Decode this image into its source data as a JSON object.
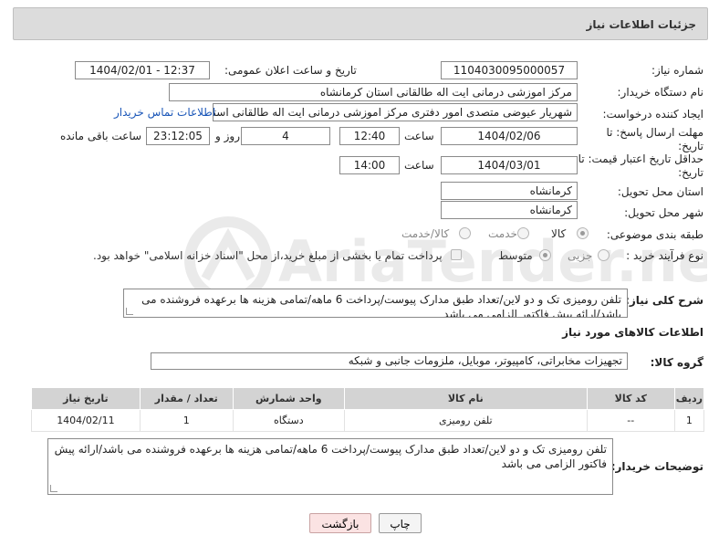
{
  "header": {
    "title": "جزئیات اطلاعات نیاز"
  },
  "labels": {
    "need_number": "شماره نیاز:",
    "announce_datetime": "تاریخ و ساعت اعلان عمومی:",
    "buyer_org": "نام دستگاه خریدار:",
    "requester": "ایجاد کننده درخواست:",
    "reply_deadline": "مهلت ارسال پاسخ: تا تاریخ:",
    "time_word": "ساعت",
    "day_and": "روز و",
    "remaining": "ساعت باقی مانده",
    "price_validity": "حداقل تاریخ اعتبار قیمت: تا تاریخ:",
    "delivery_province": "استان محل تحویل:",
    "delivery_city": "شهر محل تحویل:",
    "category": "طبقه بندی موضوعی:",
    "process_type": "نوع فرآیند خرید :",
    "description": "شرح کلی نیاز:",
    "goods_info": "اطلاعات کالاهای مورد نیاز",
    "goods_group": "گروه کالا:",
    "buyer_notes": "توضیحات خریدار:"
  },
  "fields": {
    "need_number": "1104030095000057",
    "announce_datetime": "1404/02/01 - 12:37",
    "buyer_org": "مرکز اموزشی درمانی ایت اله طالقانی استان کرمانشاه",
    "requester": "شهریار عیوضی متصدی امور دفتری مرکز اموزشی درمانی ایت اله طالقانی استان",
    "contact_link": "اطلاعات تماس خریدار",
    "reply_date": "1404/02/06",
    "reply_time": "12:40",
    "reply_days": "4",
    "reply_remaining": "23:12:05",
    "validity_date": "1404/03/01",
    "validity_time": "14:00",
    "province": "کرمانشاه",
    "city": "کرمانشاه",
    "description": "تلفن رومیزی تک و دو لاین/تعداد طبق مدارک پیوست/پرداخت 6 ماهه/تمامی هزینه ها برعهده فروشنده می باشد/ارائه پیش فاکتور الزامی می باشد",
    "goods_group": "تجهیزات مخابراتی، کامپیوتر، موبایل، ملزومات جانبی و شبکه",
    "buyer_notes": "تلفن رومیزی تک و دو لاین/تعداد طبق مدارک پیوست/پرداخت 6 ماهه/تمامی هزینه ها برعهده فروشنده می باشد/ارائه پیش فاکتور الزامی می باشد"
  },
  "category_options": [
    {
      "label": "کالا",
      "selected": true
    },
    {
      "label": "خدمت",
      "selected": false
    },
    {
      "label": "کالا/خدمت",
      "selected": false
    }
  ],
  "process_options": [
    {
      "label": "جزیی",
      "selected": false
    },
    {
      "label": "متوسط",
      "selected": true
    }
  ],
  "payment_note": "پرداخت تمام یا بخشی از مبلغ خرید،از محل \"اسناد خزانه اسلامی\" خواهد بود.",
  "table": {
    "headers": [
      "ردیف",
      "کد کالا",
      "نام کالا",
      "واحد شمارش",
      "تعداد / مقدار",
      "تاریخ نیاز"
    ],
    "rows": [
      [
        "1",
        "--",
        "تلفن رومیزی",
        "دستگاه",
        "1",
        "1404/02/11"
      ]
    ]
  },
  "buttons": {
    "print": "چاپ",
    "back": "بازگشت"
  },
  "watermark_text": "AriaTender.neT"
}
